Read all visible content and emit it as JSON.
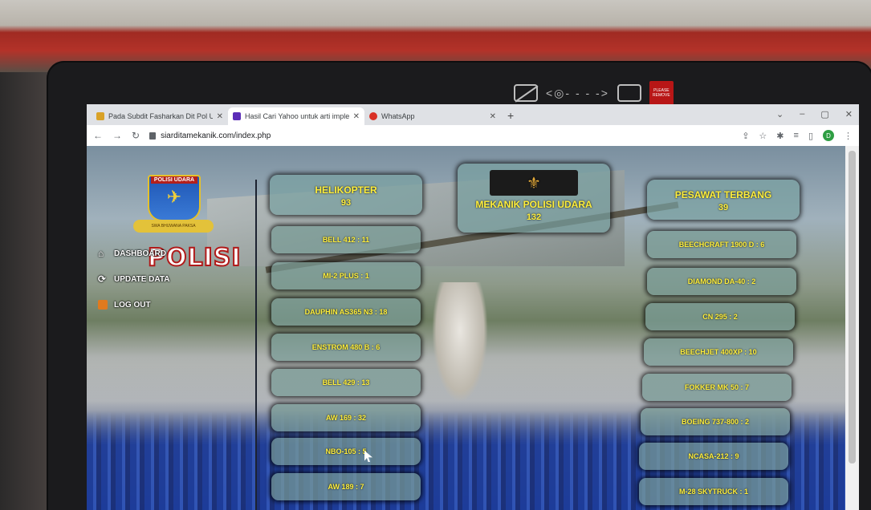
{
  "browser": {
    "tabs": [
      {
        "label": "Pada Subdit Fasharkan Dit Pol U...",
        "color": "#d9a227"
      },
      {
        "label": "Hasil Cari Yahoo untuk arti imple...",
        "color": "#5b2db8"
      },
      {
        "label": "WhatsApp",
        "color": "#d93025"
      }
    ],
    "new_tab": "+",
    "url": "siarditamekanik.com/index.php",
    "profile_initial": "D"
  },
  "webcam": {
    "sticker_text": "PLEASE REMOVE"
  },
  "logo": {
    "top_text": "POLISI UDARA",
    "ribbon_text": "SWA BHUWANA PAKSA"
  },
  "nav": {
    "dashboard": "DASHBOARD",
    "update_data": "UPDATE DATA",
    "logout": "LOG OUT"
  },
  "banner": "POLISI",
  "helikopter": {
    "title": "HELIKOPTER",
    "count": "93",
    "items": [
      "BELL 412 : 11",
      "MI-2 PLUS : 1",
      "DAUPHIN AS365 N3 : 18",
      "ENSTROM 480 B : 6",
      "BELL 429 : 13",
      "AW 169 : 32",
      "NBO-105 : 5",
      "AW 189 : 7"
    ]
  },
  "mekanik": {
    "title": "MEKANIK POLISI UDARA",
    "count": "132"
  },
  "pesawat": {
    "title": "PESAWAT TERBANG",
    "count": "39",
    "items": [
      "BEECHCRAFT 1900 D : 6",
      "DIAMOND DA-40 : 2",
      "CN 295 : 2",
      "BEECHJET 400XP : 10",
      "FOKKER MK 50 : 7",
      "BOEING 737-800 : 2",
      "NCASA-212 : 9",
      "M-28 SKYTRUCK : 1"
    ]
  }
}
